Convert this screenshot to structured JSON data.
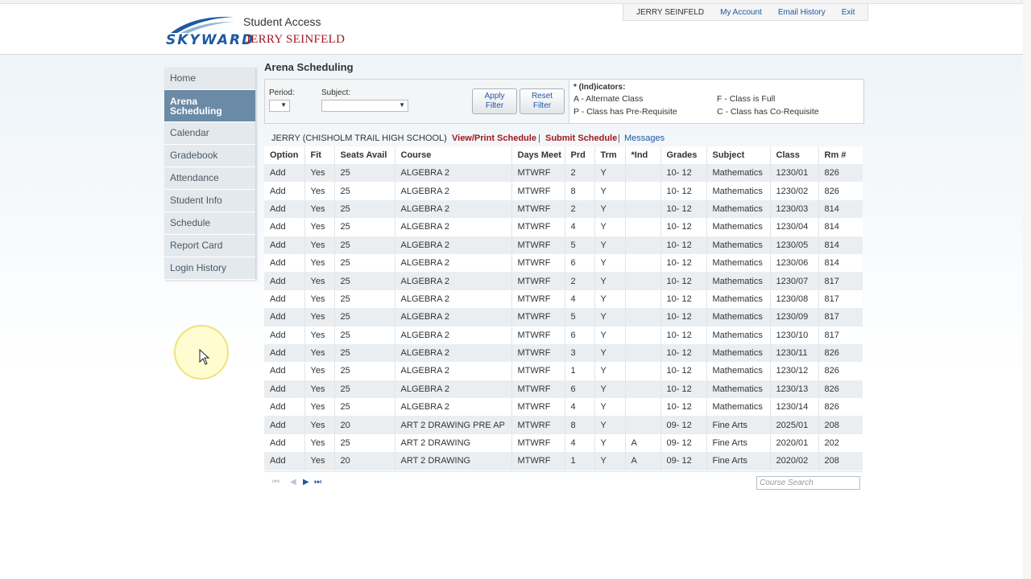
{
  "header": {
    "logo_text": "SKYWARD",
    "app_title": "Student Access",
    "user_name": "JERRY SEINFELD",
    "nav": [
      "JERRY SEINFELD",
      "My Account",
      "Email History",
      "Exit"
    ]
  },
  "sidebar": {
    "items": [
      "Home",
      "Arena Scheduling",
      "Calendar",
      "Gradebook",
      "Attendance",
      "Student Info",
      "Schedule",
      "Report Card",
      "Login History"
    ],
    "active_line1": "Arena",
    "active_line2": "Scheduling"
  },
  "page_title": "Arena Scheduling",
  "filter": {
    "period_label": "Period:",
    "subject_label": "Subject:",
    "apply_line1": "Apply",
    "apply_line2": "Filter",
    "reset_line1": "Reset",
    "reset_line2": "Filter"
  },
  "indicators": {
    "title": "* (Ind)icators:",
    "a": "A - Alternate Class",
    "f": "F - Class is Full",
    "p": "P - Class has Pre-Requisite",
    "c": "C - Class has Co-Requisite"
  },
  "links": {
    "student": "JERRY (CHISHOLM TRAIL HIGH SCHOOL)",
    "view_print": "View/Print Schedule",
    "submit": "Submit Schedule",
    "messages": "Messages",
    "sep": "|"
  },
  "table": {
    "headers": [
      "Option",
      "Fit",
      "Seats Avail",
      "Course",
      "Days Meet",
      "Prd",
      "Trm",
      "*Ind",
      "Grades",
      "Subject",
      "Class",
      "Rm #"
    ],
    "rows": [
      [
        "Add",
        "Yes",
        "25",
        "ALGEBRA 2",
        "MTWRF",
        "2",
        "Y",
        "",
        "10- 12",
        "Mathematics",
        "1230/01",
        "826"
      ],
      [
        "Add",
        "Yes",
        "25",
        "ALGEBRA 2",
        "MTWRF",
        "8",
        "Y",
        "",
        "10- 12",
        "Mathematics",
        "1230/02",
        "826"
      ],
      [
        "Add",
        "Yes",
        "25",
        "ALGEBRA 2",
        "MTWRF",
        "2",
        "Y",
        "",
        "10- 12",
        "Mathematics",
        "1230/03",
        "814"
      ],
      [
        "Add",
        "Yes",
        "25",
        "ALGEBRA 2",
        "MTWRF",
        "4",
        "Y",
        "",
        "10- 12",
        "Mathematics",
        "1230/04",
        "814"
      ],
      [
        "Add",
        "Yes",
        "25",
        "ALGEBRA 2",
        "MTWRF",
        "5",
        "Y",
        "",
        "10- 12",
        "Mathematics",
        "1230/05",
        "814"
      ],
      [
        "Add",
        "Yes",
        "25",
        "ALGEBRA 2",
        "MTWRF",
        "6",
        "Y",
        "",
        "10- 12",
        "Mathematics",
        "1230/06",
        "814"
      ],
      [
        "Add",
        "Yes",
        "25",
        "ALGEBRA 2",
        "MTWRF",
        "2",
        "Y",
        "",
        "10- 12",
        "Mathematics",
        "1230/07",
        "817"
      ],
      [
        "Add",
        "Yes",
        "25",
        "ALGEBRA 2",
        "MTWRF",
        "4",
        "Y",
        "",
        "10- 12",
        "Mathematics",
        "1230/08",
        "817"
      ],
      [
        "Add",
        "Yes",
        "25",
        "ALGEBRA 2",
        "MTWRF",
        "5",
        "Y",
        "",
        "10- 12",
        "Mathematics",
        "1230/09",
        "817"
      ],
      [
        "Add",
        "Yes",
        "25",
        "ALGEBRA 2",
        "MTWRF",
        "6",
        "Y",
        "",
        "10- 12",
        "Mathematics",
        "1230/10",
        "817"
      ],
      [
        "Add",
        "Yes",
        "25",
        "ALGEBRA 2",
        "MTWRF",
        "3",
        "Y",
        "",
        "10- 12",
        "Mathematics",
        "1230/11",
        "826"
      ],
      [
        "Add",
        "Yes",
        "25",
        "ALGEBRA 2",
        "MTWRF",
        "1",
        "Y",
        "",
        "10- 12",
        "Mathematics",
        "1230/12",
        "826"
      ],
      [
        "Add",
        "Yes",
        "25",
        "ALGEBRA 2",
        "MTWRF",
        "6",
        "Y",
        "",
        "10- 12",
        "Mathematics",
        "1230/13",
        "826"
      ],
      [
        "Add",
        "Yes",
        "25",
        "ALGEBRA 2",
        "MTWRF",
        "4",
        "Y",
        "",
        "10- 12",
        "Mathematics",
        "1230/14",
        "826"
      ],
      [
        "Add",
        "Yes",
        "20",
        "ART 2 DRAWING PRE AP",
        "MTWRF",
        "8",
        "Y",
        "",
        "09- 12",
        "Fine Arts",
        "2025/01",
        "208"
      ],
      [
        "Add",
        "Yes",
        "25",
        "ART 2 DRAWING",
        "MTWRF",
        "4",
        "Y",
        "A",
        "09- 12",
        "Fine Arts",
        "2020/01",
        "202"
      ],
      [
        "Add",
        "Yes",
        "20",
        "ART 2 DRAWING",
        "MTWRF",
        "1",
        "Y",
        "A",
        "09- 12",
        "Fine Arts",
        "2020/02",
        "208"
      ]
    ]
  },
  "pager": {
    "first": "⏮",
    "prev": "◀",
    "next": "▶",
    "last": "⏭",
    "search_placeholder": "Course Search"
  },
  "colors": {
    "accent_blue": "#1d5aa0",
    "accent_red": "#a1181d",
    "sidebar_active": "#6b8aa6"
  }
}
